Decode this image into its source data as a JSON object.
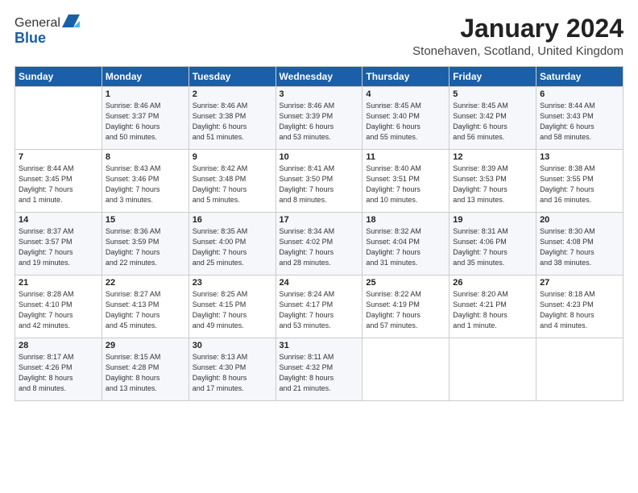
{
  "header": {
    "logo_general": "General",
    "logo_blue": "Blue",
    "month_title": "January 2024",
    "subtitle": "Stonehaven, Scotland, United Kingdom"
  },
  "weekdays": [
    "Sunday",
    "Monday",
    "Tuesday",
    "Wednesday",
    "Thursday",
    "Friday",
    "Saturday"
  ],
  "weeks": [
    [
      {
        "day": "",
        "info": ""
      },
      {
        "day": "1",
        "info": "Sunrise: 8:46 AM\nSunset: 3:37 PM\nDaylight: 6 hours\nand 50 minutes."
      },
      {
        "day": "2",
        "info": "Sunrise: 8:46 AM\nSunset: 3:38 PM\nDaylight: 6 hours\nand 51 minutes."
      },
      {
        "day": "3",
        "info": "Sunrise: 8:46 AM\nSunset: 3:39 PM\nDaylight: 6 hours\nand 53 minutes."
      },
      {
        "day": "4",
        "info": "Sunrise: 8:45 AM\nSunset: 3:40 PM\nDaylight: 6 hours\nand 55 minutes."
      },
      {
        "day": "5",
        "info": "Sunrise: 8:45 AM\nSunset: 3:42 PM\nDaylight: 6 hours\nand 56 minutes."
      },
      {
        "day": "6",
        "info": "Sunrise: 8:44 AM\nSunset: 3:43 PM\nDaylight: 6 hours\nand 58 minutes."
      }
    ],
    [
      {
        "day": "7",
        "info": "Sunrise: 8:44 AM\nSunset: 3:45 PM\nDaylight: 7 hours\nand 1 minute."
      },
      {
        "day": "8",
        "info": "Sunrise: 8:43 AM\nSunset: 3:46 PM\nDaylight: 7 hours\nand 3 minutes."
      },
      {
        "day": "9",
        "info": "Sunrise: 8:42 AM\nSunset: 3:48 PM\nDaylight: 7 hours\nand 5 minutes."
      },
      {
        "day": "10",
        "info": "Sunrise: 8:41 AM\nSunset: 3:50 PM\nDaylight: 7 hours\nand 8 minutes."
      },
      {
        "day": "11",
        "info": "Sunrise: 8:40 AM\nSunset: 3:51 PM\nDaylight: 7 hours\nand 10 minutes."
      },
      {
        "day": "12",
        "info": "Sunrise: 8:39 AM\nSunset: 3:53 PM\nDaylight: 7 hours\nand 13 minutes."
      },
      {
        "day": "13",
        "info": "Sunrise: 8:38 AM\nSunset: 3:55 PM\nDaylight: 7 hours\nand 16 minutes."
      }
    ],
    [
      {
        "day": "14",
        "info": "Sunrise: 8:37 AM\nSunset: 3:57 PM\nDaylight: 7 hours\nand 19 minutes."
      },
      {
        "day": "15",
        "info": "Sunrise: 8:36 AM\nSunset: 3:59 PM\nDaylight: 7 hours\nand 22 minutes."
      },
      {
        "day": "16",
        "info": "Sunrise: 8:35 AM\nSunset: 4:00 PM\nDaylight: 7 hours\nand 25 minutes."
      },
      {
        "day": "17",
        "info": "Sunrise: 8:34 AM\nSunset: 4:02 PM\nDaylight: 7 hours\nand 28 minutes."
      },
      {
        "day": "18",
        "info": "Sunrise: 8:32 AM\nSunset: 4:04 PM\nDaylight: 7 hours\nand 31 minutes."
      },
      {
        "day": "19",
        "info": "Sunrise: 8:31 AM\nSunset: 4:06 PM\nDaylight: 7 hours\nand 35 minutes."
      },
      {
        "day": "20",
        "info": "Sunrise: 8:30 AM\nSunset: 4:08 PM\nDaylight: 7 hours\nand 38 minutes."
      }
    ],
    [
      {
        "day": "21",
        "info": "Sunrise: 8:28 AM\nSunset: 4:10 PM\nDaylight: 7 hours\nand 42 minutes."
      },
      {
        "day": "22",
        "info": "Sunrise: 8:27 AM\nSunset: 4:13 PM\nDaylight: 7 hours\nand 45 minutes."
      },
      {
        "day": "23",
        "info": "Sunrise: 8:25 AM\nSunset: 4:15 PM\nDaylight: 7 hours\nand 49 minutes."
      },
      {
        "day": "24",
        "info": "Sunrise: 8:24 AM\nSunset: 4:17 PM\nDaylight: 7 hours\nand 53 minutes."
      },
      {
        "day": "25",
        "info": "Sunrise: 8:22 AM\nSunset: 4:19 PM\nDaylight: 7 hours\nand 57 minutes."
      },
      {
        "day": "26",
        "info": "Sunrise: 8:20 AM\nSunset: 4:21 PM\nDaylight: 8 hours\nand 1 minute."
      },
      {
        "day": "27",
        "info": "Sunrise: 8:18 AM\nSunset: 4:23 PM\nDaylight: 8 hours\nand 4 minutes."
      }
    ],
    [
      {
        "day": "28",
        "info": "Sunrise: 8:17 AM\nSunset: 4:26 PM\nDaylight: 8 hours\nand 8 minutes."
      },
      {
        "day": "29",
        "info": "Sunrise: 8:15 AM\nSunset: 4:28 PM\nDaylight: 8 hours\nand 13 minutes."
      },
      {
        "day": "30",
        "info": "Sunrise: 8:13 AM\nSunset: 4:30 PM\nDaylight: 8 hours\nand 17 minutes."
      },
      {
        "day": "31",
        "info": "Sunrise: 8:11 AM\nSunset: 4:32 PM\nDaylight: 8 hours\nand 21 minutes."
      },
      {
        "day": "",
        "info": ""
      },
      {
        "day": "",
        "info": ""
      },
      {
        "day": "",
        "info": ""
      }
    ]
  ]
}
